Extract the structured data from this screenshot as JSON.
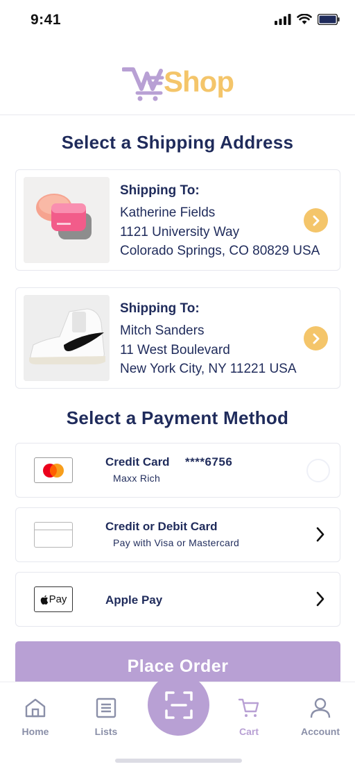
{
  "status_bar": {
    "time": "9:41"
  },
  "header": {
    "logo_part1": "WE",
    "logo_part2": "Shop"
  },
  "shipping": {
    "title": "Select a Shipping Address",
    "addresses": [
      {
        "heading": "Shipping To:",
        "name": "Katherine Fields",
        "street": "1121 University Way",
        "city": "Colorado Springs, CO 80829 USA",
        "thumbnail": "lip-mask-product-image"
      },
      {
        "heading": "Shipping To:",
        "name": "Mitch Sanders",
        "street": "11 West Boulevard",
        "city": "New York City, NY 11221 USA",
        "thumbnail": "sneaker-product-image"
      }
    ]
  },
  "payment": {
    "title": "Select a Payment Method",
    "methods": [
      {
        "title": "Credit Card",
        "masked": "****6756",
        "subtitle": "Maxx Rich",
        "icon": "mastercard-icon",
        "control": "radio"
      },
      {
        "title": "Credit or Debit Card",
        "subtitle": "Pay with Visa or Mastercard",
        "icon": "card-icon",
        "control": "chevron"
      },
      {
        "title": "Apple Pay",
        "icon": "apple-pay-icon",
        "icon_text": "Pay",
        "control": "chevron"
      }
    ]
  },
  "place_order": {
    "label": "Place Order"
  },
  "tab_bar": {
    "home": "Home",
    "lists": "Lists",
    "cart": "Cart",
    "account": "Account"
  },
  "colors": {
    "accent_purple": "#b8a0d4",
    "accent_yellow": "#f4c56a",
    "navy": "#1f2b5b"
  }
}
